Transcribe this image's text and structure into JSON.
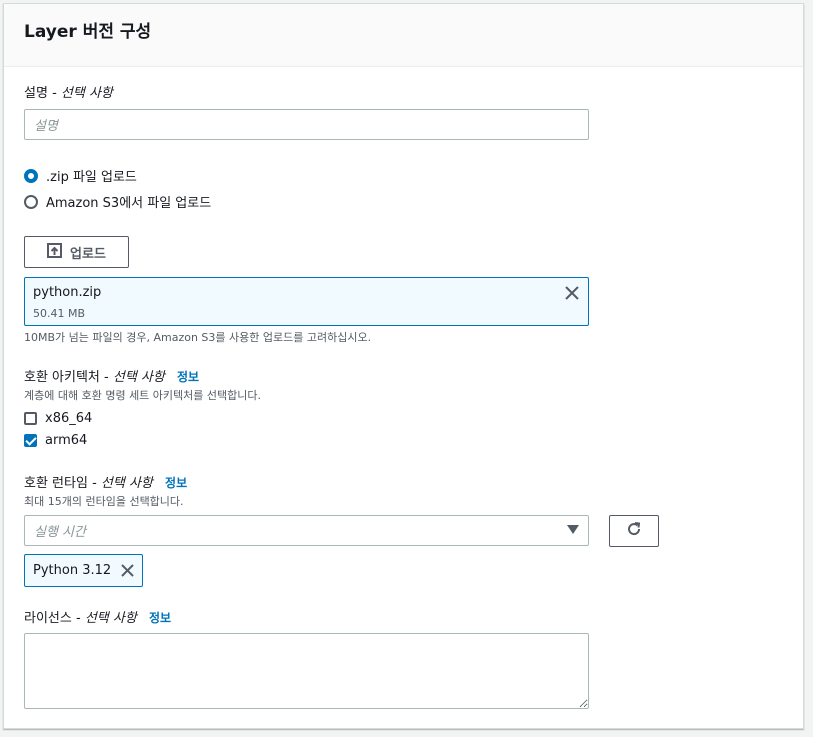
{
  "panel": {
    "title": "Layer 버전 구성"
  },
  "description": {
    "label": "설명",
    "optional": "선택 사항",
    "placeholder": "설명"
  },
  "upload_source": {
    "options": [
      {
        "label": ".zip 파일 업로드",
        "selected": true
      },
      {
        "label": "Amazon S3에서 파일 업로드",
        "selected": false
      }
    ]
  },
  "upload": {
    "button_label": "업로드",
    "file_name": "python.zip",
    "file_size": "50.41 MB",
    "hint": "10MB가 넘는 파일의 경우, Amazon S3를 사용한 업로드를 고려하십시오."
  },
  "architectures": {
    "label": "호환 아키텍처",
    "optional": "선택 사항",
    "info": "정보",
    "description": "계층에 대해 호환 명령 세트 아키텍처를 선택합니다.",
    "options": [
      {
        "label": "x86_64",
        "checked": false
      },
      {
        "label": "arm64",
        "checked": true
      }
    ]
  },
  "runtimes": {
    "label": "호환 런타임",
    "optional": "선택 사항",
    "info": "정보",
    "description": "최대 15개의 런타임을 선택합니다.",
    "placeholder": "실행 시간",
    "selected": [
      "Python 3.12"
    ]
  },
  "license": {
    "label": "라이선스",
    "optional": "선택 사항",
    "info": "정보",
    "value": ""
  },
  "colors": {
    "accent": "#0073bb",
    "border": "#aab7b8",
    "token_bg": "#f1faff"
  },
  "icons": {
    "upload": "upload-icon",
    "remove": "close-icon",
    "dropdown": "caret-down-icon",
    "refresh": "refresh-icon",
    "resize": "resize-handle-icon"
  }
}
